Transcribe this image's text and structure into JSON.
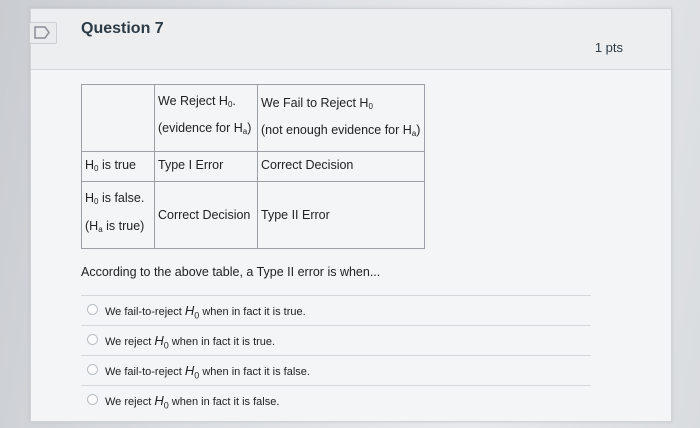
{
  "question": {
    "title": "Question 7",
    "points": "1 pts"
  },
  "table": {
    "head_reject_line1": "We Reject H",
    "head_reject_line2": "(evidence for H",
    "head_fail_line1": "We Fail to Reject H",
    "head_fail_line2": "(not enough evidence for H",
    "sub_0": "0",
    "sub_a": "a",
    "row1_label": "H",
    "row1_label_rest": " is true",
    "row1_reject": "Type I Error",
    "row1_fail": "Correct Decision",
    "row2_label_line1": "H",
    "row2_label_line1_rest": " is false.",
    "row2_label_line2_open": "(H",
    "row2_label_line2_rest": " is true)",
    "row2_reject": "Correct Decision",
    "row2_fail": "Type II Error"
  },
  "prompt": "According to the above table, a Type II error is when...",
  "answers": [
    {
      "pre": "We fail-to-reject ",
      "var": "H",
      "sub": "0",
      "post": " when in fact it is true."
    },
    {
      "pre": "We reject ",
      "var": "H",
      "sub": "0",
      "post": " when in fact it is true."
    },
    {
      "pre": "We fail-to-reject ",
      "var": "H",
      "sub": "0",
      "post": " when in fact it is false."
    },
    {
      "pre": "We reject ",
      "var": "H",
      "sub": "0",
      "post": " when in fact it is false."
    }
  ]
}
